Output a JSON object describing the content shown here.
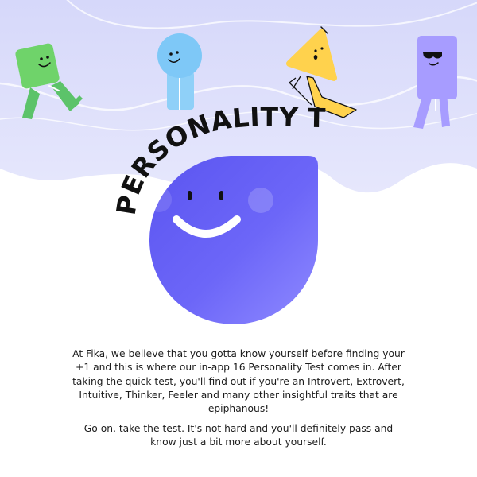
{
  "header": {
    "title": "PERSONALITY TEST"
  },
  "body": {
    "paragraph_1": "At Fika, we believe that you gotta know yourself before finding your +1 and this is where our in-app 16 Personality Test comes in. After taking the quick test, you'll find out if you're an Introvert, Extrovert, Intuitive, Thinker, Feeler and many other insightful traits that are epiphanous!",
    "paragraph_2": "Go on, take the test. It's not hard and you'll definitely pass and know just a bit more about yourself."
  },
  "illustration": {
    "characters": [
      {
        "name": "green-square-character",
        "color": "#6fd36a",
        "mood": "smile"
      },
      {
        "name": "blue-circle-character",
        "color": "#7ec8f7",
        "mood": "smile"
      },
      {
        "name": "yellow-triangle-character",
        "color": "#ffd24d",
        "mood": "surprised"
      },
      {
        "name": "purple-rectangle-character",
        "color": "#a79cff",
        "mood": "sunglasses"
      }
    ],
    "mascot_color": "#6a63f6",
    "wave_color": "#dfe0fb"
  }
}
